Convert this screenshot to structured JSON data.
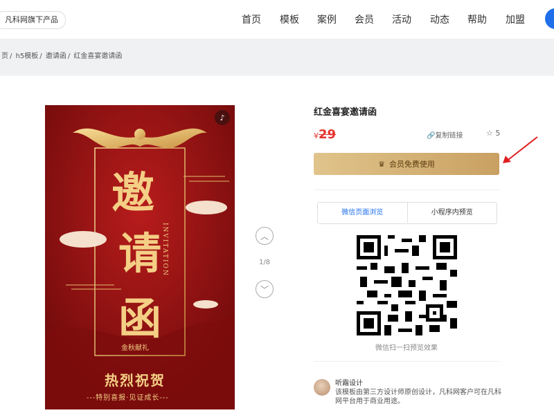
{
  "header": {
    "brand_chip": "凡科网旗下产品",
    "nav": [
      "首页",
      "模板",
      "案例",
      "会员",
      "活动",
      "动态",
      "帮助",
      "加盟"
    ]
  },
  "breadcrumb": [
    "页",
    "h5模板",
    "邀请函",
    "红金喜宴邀请函"
  ],
  "poster": {
    "main_chars": [
      "邀",
      "请",
      "函"
    ],
    "english": "INVITATION",
    "small_subtext": "金秋献礼",
    "greeting": "热烈祝贺",
    "slogan": "---特别喜报·见证成长---",
    "badge_icon": "tiktok-icon"
  },
  "pager": {
    "indicator": "1/8"
  },
  "product": {
    "title": "红金喜宴邀请函",
    "currency": "¥",
    "price": "29",
    "copy_link": "复制链接",
    "star_count": "5",
    "member_button": "会员免费使用"
  },
  "preview": {
    "tabs": [
      "微信页面浏览",
      "小程序内预览"
    ],
    "qr_caption": "微信扫一扫预览效果"
  },
  "author": {
    "name": "听霜设计",
    "description": "该模板由第三方设计师原创设计，凡科网客户可在凡科网平台用于商业用途。"
  },
  "colors": {
    "accent_blue": "#1f6feb",
    "price_red": "#e5322d",
    "gold": "#c9a062",
    "poster_red": "#9a1414"
  }
}
